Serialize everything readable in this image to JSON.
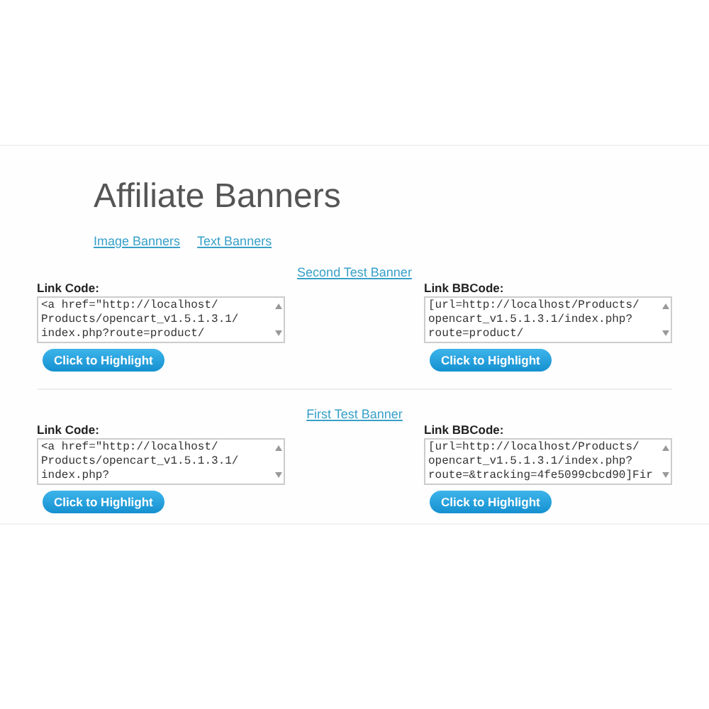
{
  "page_title": "Affiliate Banners",
  "tabs": [
    {
      "label": "Image Banners"
    },
    {
      "label": "Text Banners"
    }
  ],
  "banners": [
    {
      "title": "Second Test Banner",
      "fields": [
        {
          "label": "Link Code:",
          "lines": [
            "<a href=\"http://localhost/",
            "Products/opencart_v1.5.1.3.1/",
            "index.php?route=product/"
          ],
          "button": "Click to Highlight"
        },
        {
          "label": "Link BBCode:",
          "lines": [
            "[url=http://localhost/Products/",
            "opencart_v1.5.1.3.1/index.php?",
            "route=product/"
          ],
          "button": "Click to Highlight"
        }
      ]
    },
    {
      "title": "First Test Banner",
      "fields": [
        {
          "label": "Link Code:",
          "lines": [
            "<a href=\"http://localhost/",
            "Products/opencart_v1.5.1.3.1/",
            "index.php?"
          ],
          "button": "Click to Highlight"
        },
        {
          "label": "Link BBCode:",
          "lines": [
            "[url=http://localhost/Products/",
            "opencart_v1.5.1.3.1/index.php?",
            "route=&tracking=4fe5099cbcd90]Fir"
          ],
          "button": "Click to Highlight"
        }
      ]
    }
  ]
}
